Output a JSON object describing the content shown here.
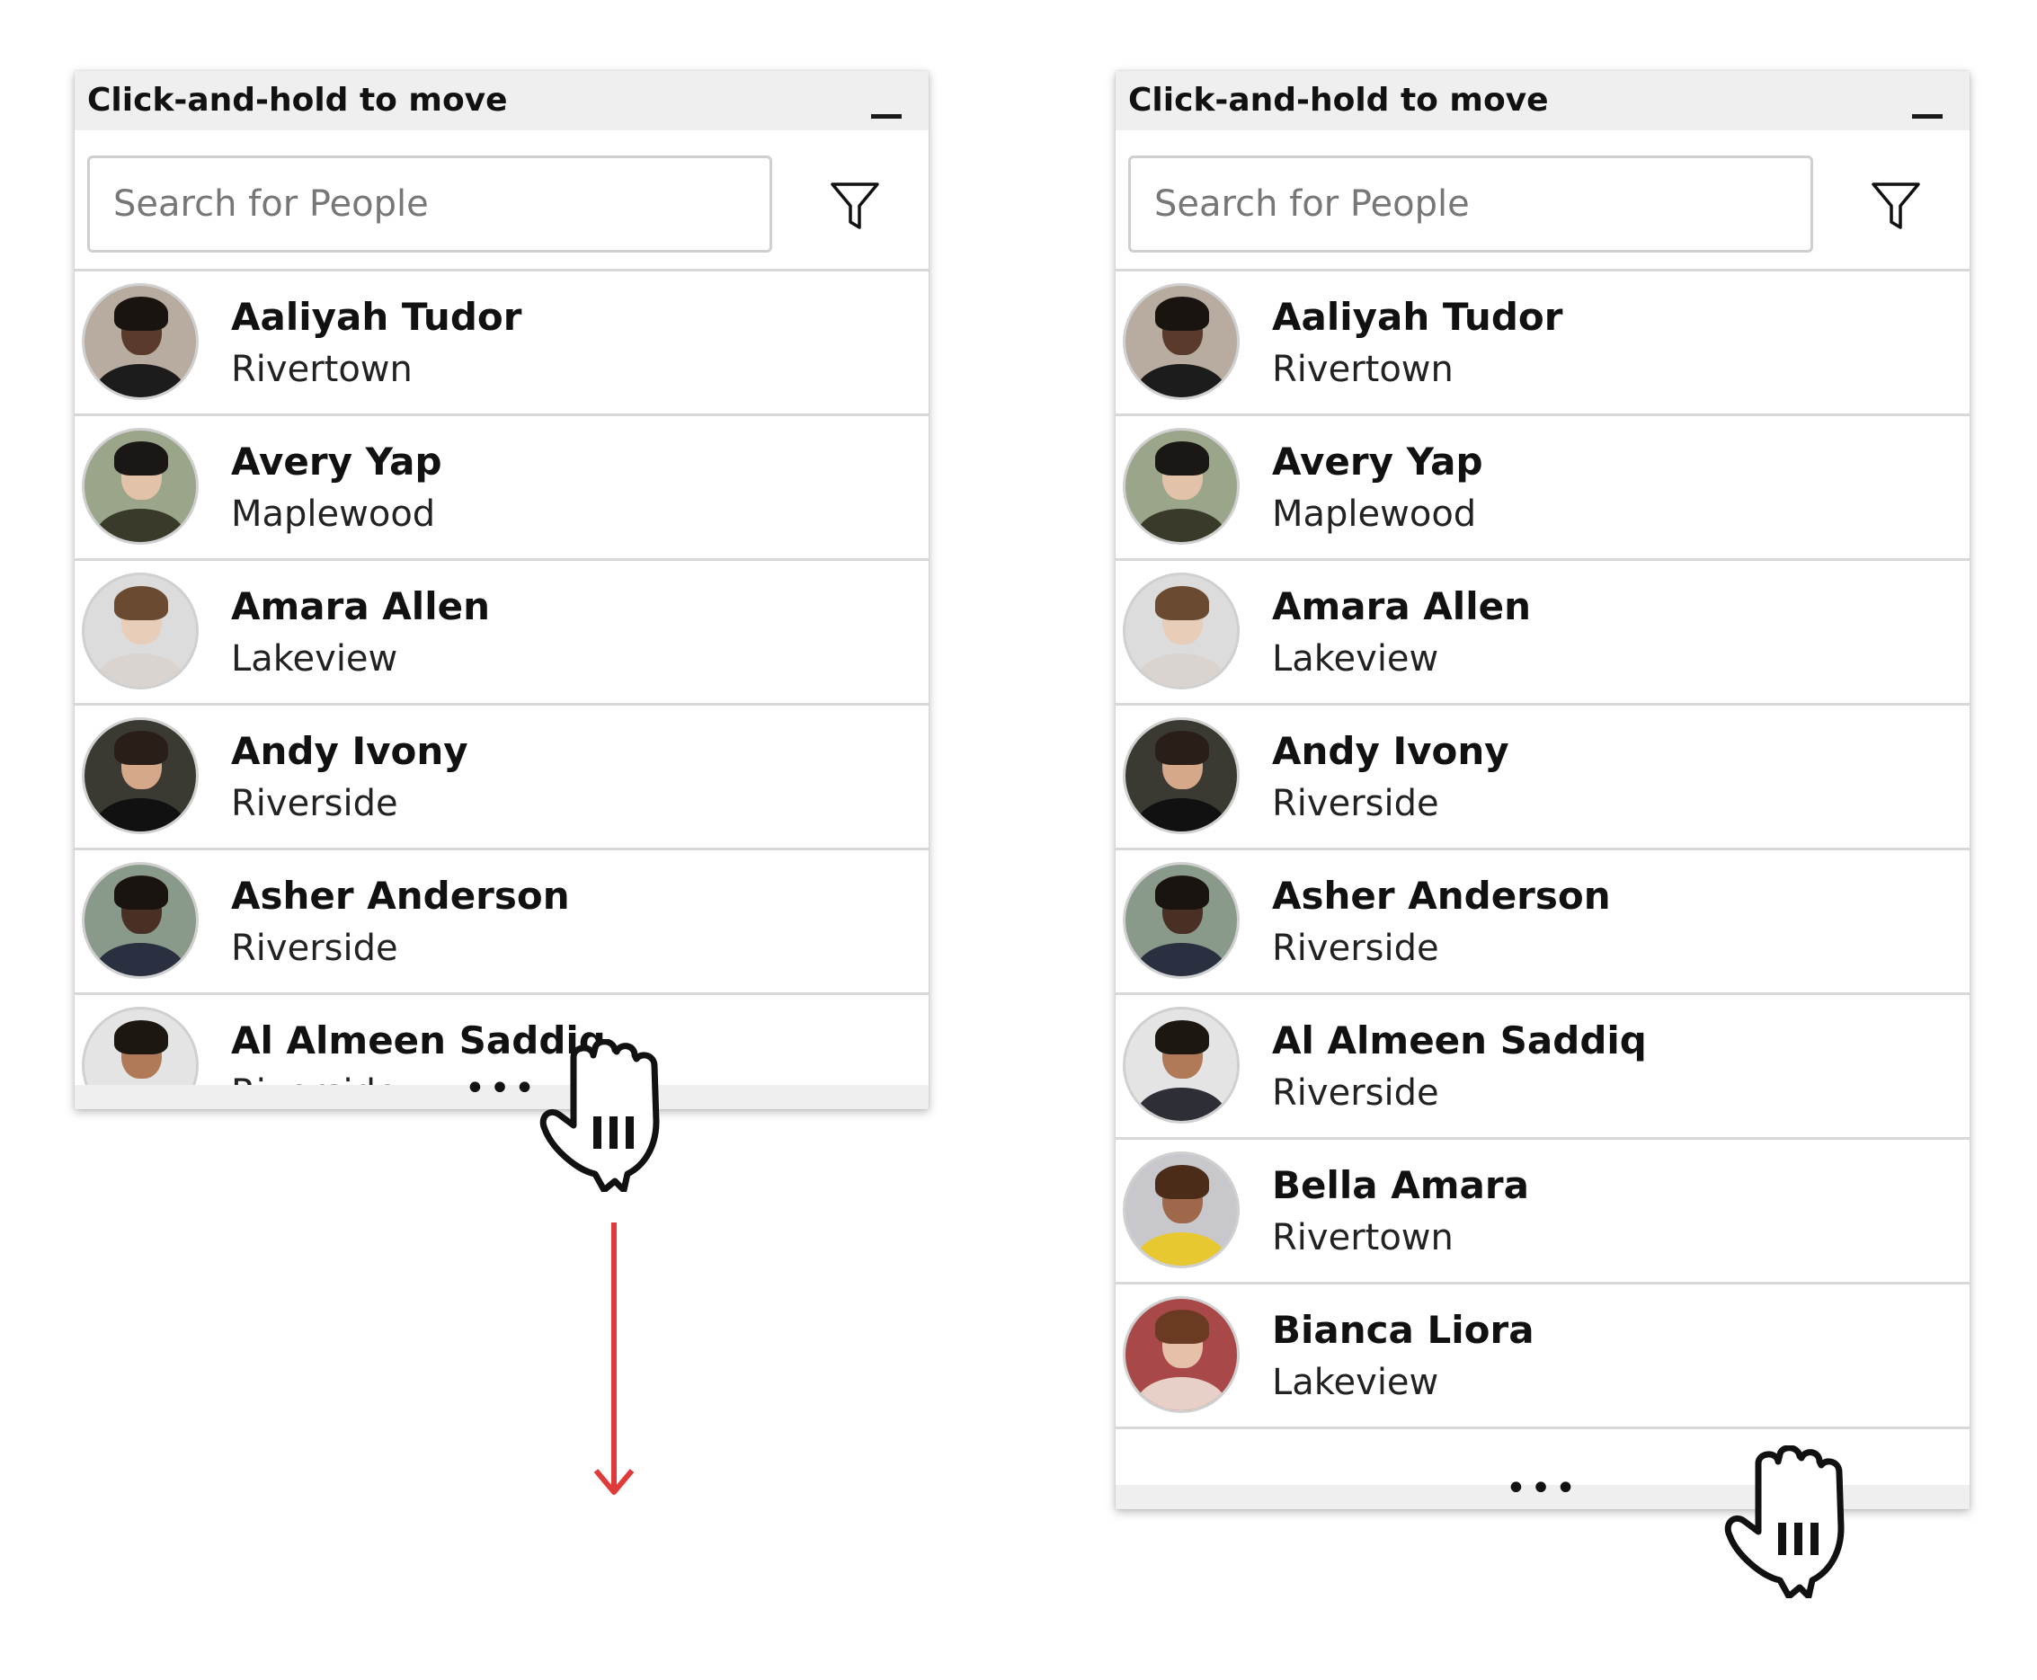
{
  "panels": [
    {
      "title": "Click-and-hold to move",
      "search_placeholder": "Search for People",
      "footer_handle": "•••",
      "people": [
        {
          "name": "Aaliyah Tudor",
          "city": "Rivertown"
        },
        {
          "name": "Avery Yap",
          "city": "Maplewood"
        },
        {
          "name": "Amara Allen",
          "city": "Lakeview"
        },
        {
          "name": "Andy Ivony",
          "city": "Riverside"
        },
        {
          "name": "Asher Anderson",
          "city": "Riverside"
        },
        {
          "name": "Al Almeen Saddiq",
          "city": "Riverside"
        }
      ]
    },
    {
      "title": "Click-and-hold to move",
      "search_placeholder": "Search for People",
      "footer_handle": "•••",
      "people": [
        {
          "name": "Aaliyah Tudor",
          "city": "Rivertown"
        },
        {
          "name": "Avery Yap",
          "city": "Maplewood"
        },
        {
          "name": "Amara Allen",
          "city": "Lakeview"
        },
        {
          "name": "Andy Ivony",
          "city": "Riverside"
        },
        {
          "name": "Asher Anderson",
          "city": "Riverside"
        },
        {
          "name": "Al Almeen Saddiq",
          "city": "Riverside"
        },
        {
          "name": "Bella Amara",
          "city": "Rivertown"
        },
        {
          "name": "Bianca Liora",
          "city": "Lakeview"
        }
      ]
    }
  ],
  "colors": {
    "titlebar": "#efefef",
    "divider": "#d8d8d8",
    "arrow": "#e03a3a"
  },
  "icons": {
    "minimize": "minimize-icon",
    "filter": "filter-icon",
    "drag_cursor": "grab-hand-cursor-icon",
    "direction": "down-arrow-icon"
  }
}
